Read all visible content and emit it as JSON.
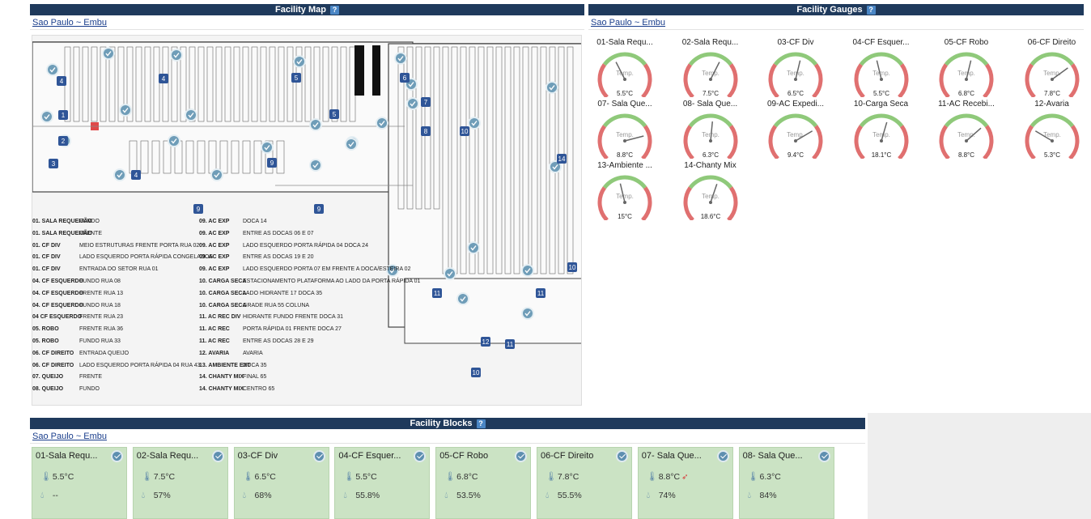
{
  "map_panel": {
    "title": "Facility Map",
    "help": "?",
    "location": "Sao Paulo ~ Embu",
    "legend_left": [
      {
        "k": "01. SALA REQUEIJÃO",
        "v": "FUNDO"
      },
      {
        "k": "01. SALA REQUEIJÃO",
        "v": "FRENTE"
      },
      {
        "k": "01. CF DIV",
        "v": "MEIO ESTRUTURAS FRENTE PORTA RUA 02"
      },
      {
        "k": "01. CF DIV",
        "v": "LADO ESQUERDO PORTA RÁPIDA CONGELADOS"
      },
      {
        "k": "01. CF DIV",
        "v": "ENTRADA DO SETOR RUA 01"
      },
      {
        "k": "04. CF ESQUERDO",
        "v": "FUNDO RUA 08"
      },
      {
        "k": "04. CF ESQUERDO",
        "v": "FRENTE RUA 13"
      },
      {
        "k": "04. CF ESQUERDO",
        "v": "FUNDO RUA 18"
      },
      {
        "k": "04 CF ESQUERDO",
        "v": "FRENTE RUA 23"
      },
      {
        "k": "05. ROBO",
        "v": "FRENTE RUA 36"
      },
      {
        "k": "05. ROBO",
        "v": "FUNDO RUA 33"
      },
      {
        "k": "06. CF DIREITO",
        "v": "ENTRADA QUEIJO"
      },
      {
        "k": "06. CF DIREITO",
        "v": "LADO ESQUERDO PORTA RÁPIDA 04 RUA 43"
      },
      {
        "k": "07. QUEIJO",
        "v": "FRENTE"
      },
      {
        "k": "08. QUEIJO",
        "v": "FUNDO"
      }
    ],
    "legend_right": [
      {
        "k": "09. AC EXP",
        "v": "DOCA 14"
      },
      {
        "k": "09. AC EXP",
        "v": "ENTRE AS DOCAS 06 E 07"
      },
      {
        "k": "09. AC EXP",
        "v": "LADO ESQUERDO PORTA RÁPIDA 04 DOCA 24"
      },
      {
        "k": "09. AC EXP",
        "v": "ENTRE AS DOCAS 19 E 20"
      },
      {
        "k": "09. AC EXP",
        "v": "LADO ESQUERDO PORTA 07 EM FRENTE A DOCA/ESTEIRA 02"
      },
      {
        "k": "10. CARGA SECA",
        "v": "ESTACIONAMENTO PLATAFORMA AO LADO DA PORTA RÁPIDA 01"
      },
      {
        "k": "10. CARGA SECA",
        "v": "LADO HIDRANTE 17 DOCA 35"
      },
      {
        "k": "10. CARGA SECA",
        "v": "GRADE RUA 55 COLUNA"
      },
      {
        "k": "11. AC REC DIV",
        "v": "HIDRANTE FUNDO FRENTE DOCA 31"
      },
      {
        "k": "11. AC REC",
        "v": "PORTA RÁPIDA 01 FRENTE DOCA 27"
      },
      {
        "k": "11. AC REC",
        "v": "ENTRE AS DOCAS 28 E 29"
      },
      {
        "k": "12. AVARIA",
        "v": "AVARIA"
      },
      {
        "k": "13. AMBIENTE EXT",
        "v": "DOCA 35"
      },
      {
        "k": "14. CHANTY MIX",
        "v": "FINAL 65"
      },
      {
        "k": "14. CHANTY MIX",
        "v": "CENTRO 65"
      }
    ]
  },
  "gauge_panel": {
    "title": "Facility Gauges",
    "help": "?",
    "location": "Sao Paulo ~ Embu",
    "gauge_label": "Temp.",
    "gauges": [
      {
        "name": "01-Sala Requ...",
        "value": "5.5°C",
        "level": 0.4
      },
      {
        "name": "02-Sala Requ...",
        "value": "7.5°C",
        "level": 0.6
      },
      {
        "name": "03-CF Div",
        "value": "6.5°C",
        "level": 0.55
      },
      {
        "name": "04-CF Esquer...",
        "value": "5.5°C",
        "level": 0.45
      },
      {
        "name": "05-CF Robo",
        "value": "6.8°C",
        "level": 0.55
      },
      {
        "name": "06-CF Direito",
        "value": "7.8°C",
        "level": 0.7
      },
      {
        "name": "07- Sala Que...",
        "value": "8.8°C",
        "level": 0.78
      },
      {
        "name": "08- Sala Que...",
        "value": "6.3°C",
        "level": 0.52
      },
      {
        "name": "09-AC Expedi...",
        "value": "9.4°C",
        "level": 0.72
      },
      {
        "name": "10-Carga Seca",
        "value": "18.1°C",
        "level": 0.56
      },
      {
        "name": "11-AC Recebi...",
        "value": "8.8°C",
        "level": 0.68
      },
      {
        "name": "12-Avaria",
        "value": "5.3°C",
        "level": 0.28
      },
      {
        "name": "13-Ambiente ...",
        "value": "15°C",
        "level": 0.45
      },
      {
        "name": "14-Chanty Mix",
        "value": "18.6°C",
        "level": 0.57
      }
    ],
    "colors": {
      "green": "#8fc97a",
      "red": "#e07070",
      "needle": "#666666"
    }
  },
  "blocks_panel": {
    "title": "Facility Blocks",
    "help": "?",
    "location": "Sao Paulo ~ Embu",
    "blocks": [
      {
        "name": "01-Sala Requ...",
        "temp": "5.5°C",
        "hum": "--"
      },
      {
        "name": "02-Sala Requ...",
        "temp": "7.5°C",
        "hum": "57%"
      },
      {
        "name": "03-CF Div",
        "temp": "6.5°C",
        "hum": "68%"
      },
      {
        "name": "04-CF Esquer...",
        "temp": "5.5°C",
        "hum": "55.8%"
      },
      {
        "name": "05-CF Robo",
        "temp": "6.8°C",
        "hum": "53.5%"
      },
      {
        "name": "06-CF Direito",
        "temp": "7.8°C",
        "hum": "55.5%"
      },
      {
        "name": "07- Sala Que...",
        "temp": "8.8°C",
        "hum": "74%",
        "alert": true
      },
      {
        "name": "08- Sala Que...",
        "temp": "6.3°C",
        "hum": "84%"
      }
    ]
  },
  "map_markers": [
    {
      "t": "ok"
    },
    {
      "t": "ok"
    },
    {
      "t": "ok"
    },
    {
      "t": "ok"
    },
    {
      "t": "ok"
    },
    {
      "t": "ok"
    },
    {
      "t": "ok"
    },
    {
      "t": "ok"
    },
    {
      "t": "ok"
    },
    {
      "t": "ok"
    }
  ]
}
